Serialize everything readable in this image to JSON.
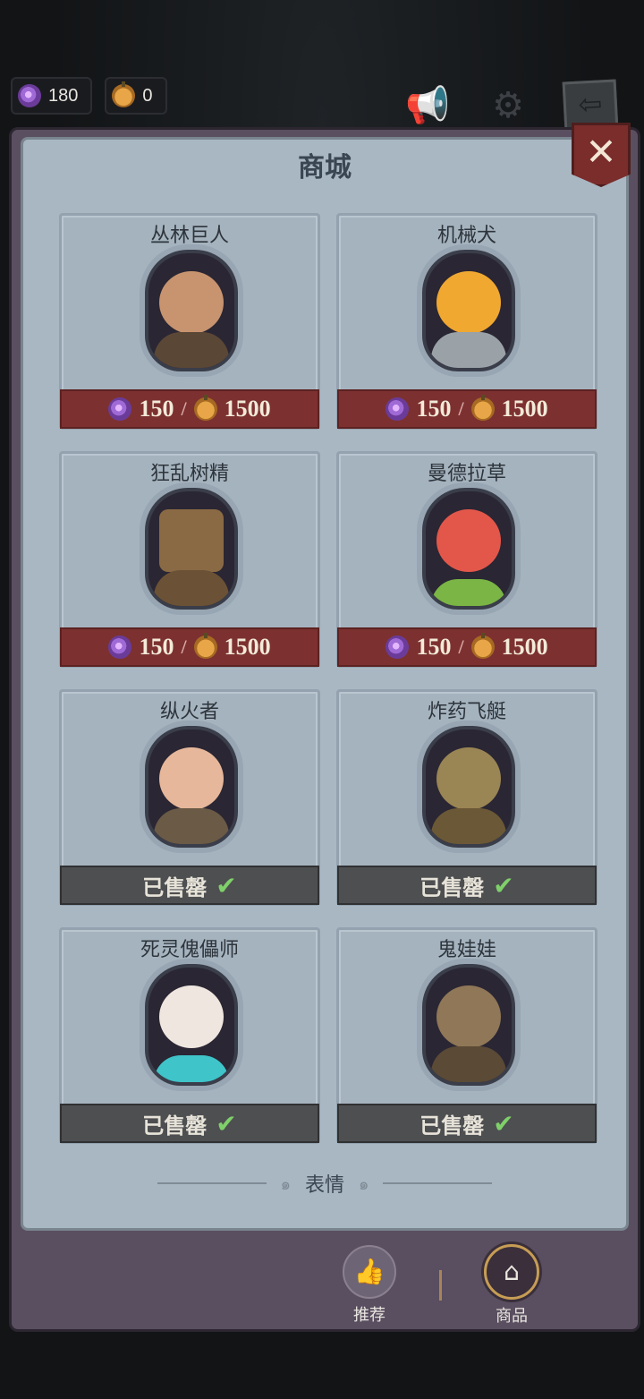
{
  "currency": {
    "candy": "180",
    "pumpkin": "0"
  },
  "shop": {
    "title": "商城",
    "close_label": "✕",
    "items": [
      {
        "name": "丛林巨人",
        "status": "price",
        "candy_price": "150",
        "pumpkin_price": "1500"
      },
      {
        "name": "机械犬",
        "status": "price",
        "candy_price": "150",
        "pumpkin_price": "1500"
      },
      {
        "name": "狂乱树精",
        "status": "price",
        "candy_price": "150",
        "pumpkin_price": "1500"
      },
      {
        "name": "曼德拉草",
        "status": "price",
        "candy_price": "150",
        "pumpkin_price": "1500"
      },
      {
        "name": "纵火者",
        "status": "sold",
        "sold_label": "已售罄"
      },
      {
        "name": "炸药飞艇",
        "status": "sold",
        "sold_label": "已售罄"
      },
      {
        "name": "死灵傀儡师",
        "status": "sold",
        "sold_label": "已售罄"
      },
      {
        "name": "鬼娃娃",
        "status": "sold",
        "sold_label": "已售罄"
      }
    ],
    "section_label": "表情"
  },
  "nav": {
    "recommend": "推荐",
    "shop": "商品"
  },
  "colors": {
    "price_bar": "#7c3130",
    "sold_bar": "#4e4f51",
    "check": "#7fd06a",
    "accent_gold": "#c79d55"
  },
  "icons": [
    "candy-icon",
    "pumpkin-icon",
    "megaphone-icon",
    "gear-icon",
    "back-icon",
    "close-icon",
    "check-icon",
    "thumbs-up-icon",
    "shop-icon"
  ]
}
